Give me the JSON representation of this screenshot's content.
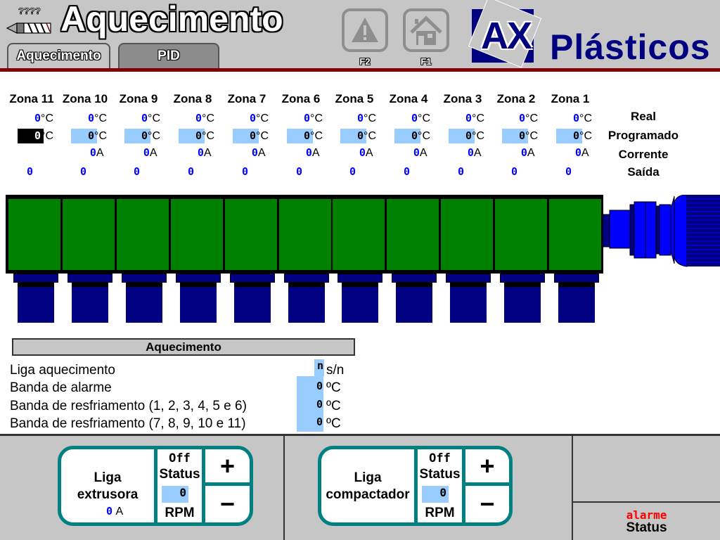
{
  "header": {
    "title": "Aquecimento",
    "tabs": [
      {
        "label": "Aquecimento",
        "active": true
      },
      {
        "label": "PID",
        "active": false
      }
    ],
    "function_keys": [
      {
        "label": "F2",
        "icon": "warning-icon"
      },
      {
        "label": "F1",
        "icon": "home-icon"
      }
    ],
    "logo": {
      "mark": "AX",
      "text": "Plásticos"
    },
    "accent_color": "#800000"
  },
  "zones": {
    "row_labels": {
      "real": "Real",
      "programado": "Programado",
      "corrente": "Corrente",
      "saida": "Saída"
    },
    "temp_unit": "°C",
    "current_unit": "A",
    "items": [
      {
        "name": "Zona 11",
        "real": "0",
        "programado": "0",
        "corrente": null,
        "saida": "0",
        "selected": true
      },
      {
        "name": "Zona 10",
        "real": "0",
        "programado": "0",
        "corrente": "0",
        "saida": "0"
      },
      {
        "name": "Zona 9",
        "real": "0",
        "programado": "0",
        "corrente": "0",
        "saida": "0"
      },
      {
        "name": "Zona 8",
        "real": "0",
        "programado": "0",
        "corrente": "0",
        "saida": "0"
      },
      {
        "name": "Zona 7",
        "real": "0",
        "programado": "0",
        "corrente": "0",
        "saida": "0"
      },
      {
        "name": "Zona 6",
        "real": "0",
        "programado": "0",
        "corrente": "0",
        "saida": "0"
      },
      {
        "name": "Zona 5",
        "real": "0",
        "programado": "0",
        "corrente": "0",
        "saida": "0"
      },
      {
        "name": "Zona 4",
        "real": "0",
        "programado": "0",
        "corrente": "0",
        "saida": "0"
      },
      {
        "name": "Zona 3",
        "real": "0",
        "programado": "0",
        "corrente": "0",
        "saida": "0"
      },
      {
        "name": "Zona 2",
        "real": "0",
        "programado": "0",
        "corrente": "0",
        "saida": "0"
      },
      {
        "name": "Zona 1",
        "real": "0",
        "programado": "0",
        "corrente": "0",
        "saida": "0"
      }
    ],
    "barrel_color": "#008000",
    "heater_color": "#000080"
  },
  "params": {
    "header": "Aquecimento",
    "rows": [
      {
        "label": "Liga aquecimento",
        "value": "n",
        "unit": "s/n"
      },
      {
        "label": "Banda de alarme",
        "value": "0",
        "unit": "ºC"
      },
      {
        "label": "Banda de resfriamento (1, 2, 3, 4, 5 e 6)",
        "value": "0",
        "unit": "ºC"
      },
      {
        "label": "Banda de resfriamento (7, 8, 9, 10 e 11)",
        "value": "0",
        "unit": "ºC"
      }
    ]
  },
  "footer": {
    "extrusora": {
      "label_line1": "Liga",
      "label_line2": "extrusora",
      "current": "0",
      "current_unit": "A",
      "state": "Off",
      "status_label": "Status",
      "rpm": "0",
      "rpm_unit": "RPM",
      "plus": "+",
      "minus": "−"
    },
    "compactador": {
      "label_line1": "Liga",
      "label_line2": "compactador",
      "state": "Off",
      "status_label": "Status",
      "rpm": "0",
      "rpm_unit": "RPM",
      "plus": "+",
      "minus": "−"
    },
    "alarm": {
      "text": "alarme",
      "status_label": "Status",
      "color": "#ff0000"
    }
  }
}
